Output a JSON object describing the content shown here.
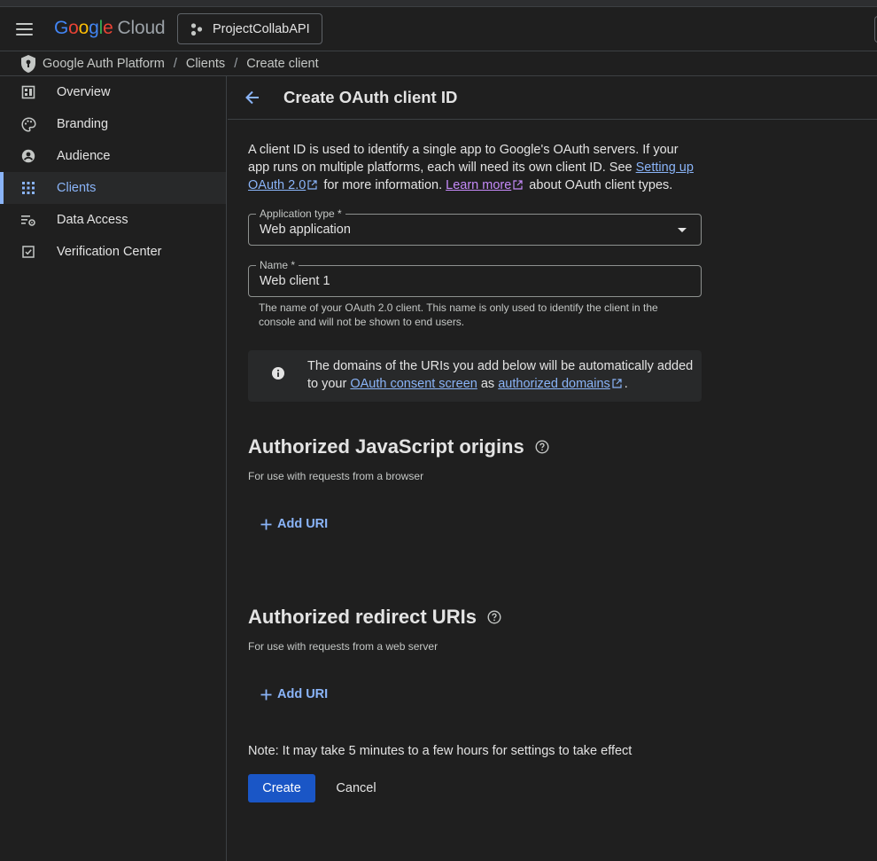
{
  "topbar": {
    "logo_letters": [
      {
        "ch": "G",
        "color": "#4285f4"
      },
      {
        "ch": "o",
        "color": "#ea4335"
      },
      {
        "ch": "o",
        "color": "#fbbc04"
      },
      {
        "ch": "g",
        "color": "#4285f4"
      },
      {
        "ch": "l",
        "color": "#34a853"
      },
      {
        "ch": "e",
        "color": "#ea4335"
      }
    ],
    "logo_suffix": "Cloud",
    "project_name": "ProjectCollabAPI"
  },
  "breadcrumb": {
    "items": [
      "Google Auth Platform",
      "Clients",
      "Create client"
    ],
    "separator": "/",
    "icon": "shield-keyhole-icon"
  },
  "sidebar": {
    "items": [
      {
        "label": "Overview",
        "icon": "dashboard-icon",
        "active": false
      },
      {
        "label": "Branding",
        "icon": "palette-icon",
        "active": false
      },
      {
        "label": "Audience",
        "icon": "account-circle-icon",
        "active": false
      },
      {
        "label": "Clients",
        "icon": "apps-grid-icon",
        "active": true
      },
      {
        "label": "Data Access",
        "icon": "settings-list-icon",
        "active": false
      },
      {
        "label": "Verification Center",
        "icon": "checkbox-icon",
        "active": false
      }
    ],
    "accent_color": "#8ab4f8"
  },
  "page": {
    "title": "Create OAuth client ID",
    "intro": {
      "text1": "A client ID is used to identify a single app to Google's OAuth servers. If your app runs on multiple platforms, each will need its own client ID. See ",
      "link1": "Setting up OAuth 2.0",
      "text2": " for more information. ",
      "link2": "Learn more",
      "text3": " about OAuth client types."
    },
    "application_type": {
      "label": "Application type *",
      "value": "Web application"
    },
    "name_field": {
      "label": "Name *",
      "value": "Web client 1",
      "hint": "The name of your OAuth 2.0 client. This name is only used to identify the client in the console and will not be shown to end users."
    },
    "info": {
      "text1": "The domains of the URIs you add below will be automatically added to your ",
      "link1": "OAuth consent screen",
      "text2": " as ",
      "link2": "authorized domains",
      "text3": "."
    },
    "js_origins": {
      "title": "Authorized JavaScript origins",
      "subtitle": "For use with requests from a browser",
      "add_label": "Add URI"
    },
    "redirect_uris": {
      "title": "Authorized redirect URIs",
      "subtitle": "For use with requests from a web server",
      "add_label": "Add URI"
    },
    "note": "Note: It may take 5 minutes to a few hours for settings to take effect",
    "create_label": "Create",
    "cancel_label": "Cancel",
    "primary_color": "#1a56c6"
  }
}
